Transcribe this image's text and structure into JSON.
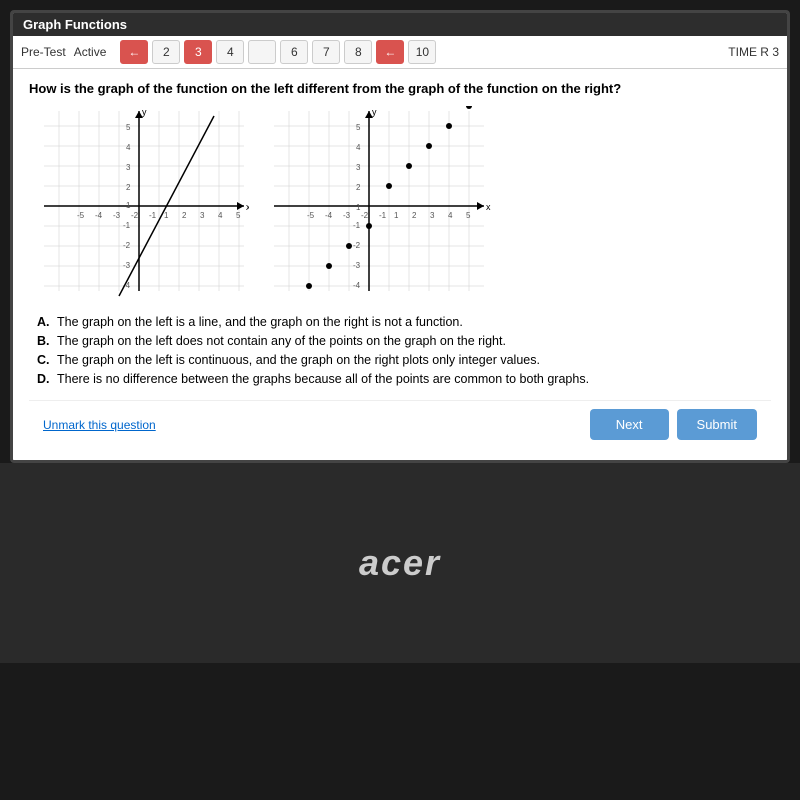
{
  "title": "Graph Functions",
  "nav": {
    "pretest_label": "Pre-Test",
    "active_label": "Active",
    "buttons": [
      "2",
      "3",
      "4",
      "",
      "6",
      "7",
      "8",
      "",
      "10"
    ],
    "current_page": "1",
    "time_label": "TIME R",
    "time_value": "3"
  },
  "question": {
    "text": "How is the graph of the function on the left different from the graph of the function on the right?"
  },
  "answers": [
    {
      "letter": "A.",
      "text": "The graph on the left is a line, and the graph on the right is not a function."
    },
    {
      "letter": "B.",
      "text": "The graph on the left does not contain any of the points on the graph on the right."
    },
    {
      "letter": "C.",
      "text": "The graph on the left is continuous, and the graph on the right plots only integer values."
    },
    {
      "letter": "D.",
      "text": "There is no difference between the graphs because all of the points are common to both graphs."
    }
  ],
  "bottom": {
    "unmark_label": "Unmark this question",
    "next_label": "Next",
    "submit_label": "Submit"
  },
  "laptop": {
    "brand": "acer"
  }
}
